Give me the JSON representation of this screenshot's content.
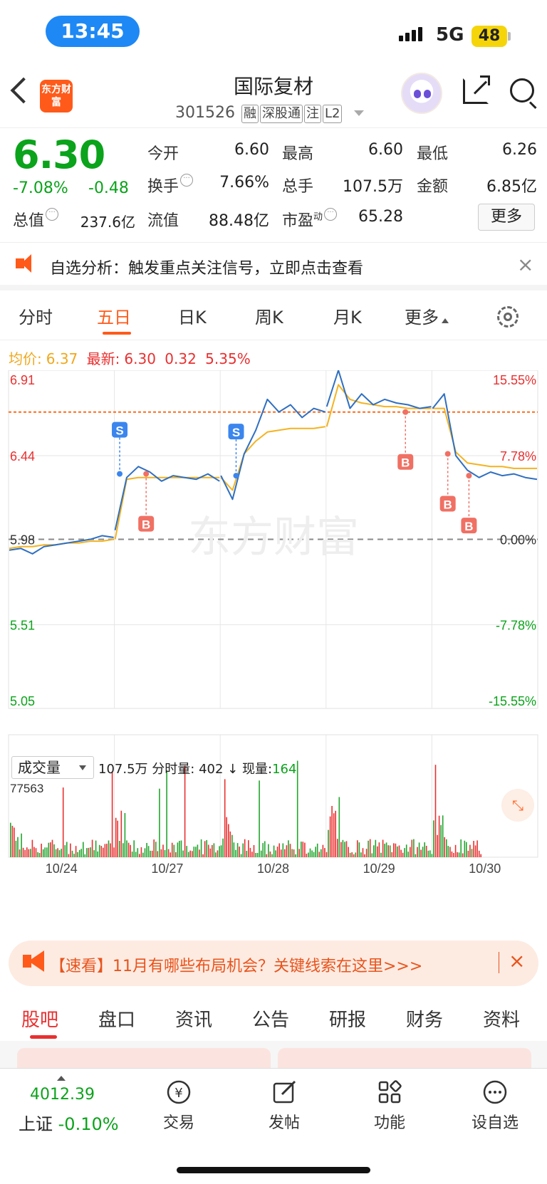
{
  "status_bar": {
    "time": "13:45",
    "network": "5G",
    "battery": "48"
  },
  "header": {
    "logo_text": "东方财富",
    "title": "国际复材",
    "code": "301526",
    "tags": [
      "融",
      "深股通",
      "注",
      "L2"
    ]
  },
  "quote": {
    "price": "6.30",
    "change_pct": "-7.08%",
    "change_amt": "-0.48",
    "open_label": "今开",
    "open": "6.60",
    "high_label": "最高",
    "high": "6.60",
    "low_label": "最低",
    "low": "6.26",
    "turnover_label": "换手",
    "turnover": "7.66%",
    "volume_label": "总手",
    "volume": "107.5万",
    "amount_label": "金额",
    "amount": "6.85亿",
    "mktcap_label": "总值",
    "mktcap": "237.6亿",
    "float_label": "流值",
    "float": "88.48亿",
    "pe_label": "市盈",
    "pe_sup": "动",
    "pe": "65.28",
    "more_label": "更多"
  },
  "notice": {
    "text": "自选分析：触发重点关注信号，立即点击查看",
    "close": "×"
  },
  "tabs": [
    "分时",
    "五日",
    "日K",
    "周K",
    "月K",
    "更多"
  ],
  "legend": {
    "avg_label": "均价:",
    "avg": "6.37",
    "latest_label": "最新:",
    "latest": "6.30",
    "change": "0.32",
    "change_pct": "5.35%"
  },
  "chart_data": {
    "type": "line",
    "title": "",
    "y_labels_left": [
      "6.91",
      "6.44",
      "5.98",
      "5.51",
      "5.05"
    ],
    "y_labels_right": [
      "15.55%",
      "7.78%",
      "0.00%",
      "-7.78%",
      "-15.55%"
    ],
    "ylim": [
      5.05,
      6.91
    ],
    "prev_close": 5.98,
    "latest": 6.3,
    "x_labels": [
      "10/24",
      "10/27",
      "10/28",
      "10/29",
      "10/30"
    ],
    "series": [
      {
        "name": "",
        "values": [
          5.92,
          5.93,
          5.9,
          5.94,
          5.95,
          5.96,
          5.97,
          5.98,
          6.0,
          5.99,
          6.03,
          6.32,
          6.38,
          6.35,
          6.3,
          6.33,
          6.32,
          6.31,
          6.34,
          6.3,
          6.33,
          6.2,
          6.45,
          6.58,
          6.75,
          6.68,
          6.72,
          6.65,
          6.7,
          6.68,
          6.71,
          6.91,
          6.7,
          6.78,
          6.72,
          6.75,
          6.73,
          6.72,
          6.7,
          6.71,
          6.7,
          6.78,
          6.44,
          6.36,
          6.32,
          6.35,
          6.33,
          6.34,
          6.32,
          6.31,
          6.3
        ]
      },
      {
        "name": "",
        "values": [
          5.93,
          5.94,
          5.94,
          5.95,
          5.95,
          5.96,
          5.96,
          5.97,
          5.97,
          5.98,
          5.98,
          6.31,
          6.32,
          6.32,
          6.32,
          6.32,
          6.32,
          6.32,
          6.32,
          6.32,
          6.32,
          6.25,
          6.45,
          6.52,
          6.57,
          6.58,
          6.59,
          6.59,
          6.59,
          6.6,
          6.6,
          6.83,
          6.75,
          6.73,
          6.72,
          6.71,
          6.71,
          6.7,
          6.7,
          6.7,
          6.7,
          6.7,
          6.46,
          6.4,
          6.39,
          6.38,
          6.38,
          6.37,
          6.37,
          6.37,
          6.37
        ]
      }
    ],
    "markers": [
      {
        "label": "S",
        "x": 0.21,
        "y": 6.34,
        "dir": "up"
      },
      {
        "label": "B",
        "x": 0.26,
        "y": 6.34,
        "dir": "down"
      },
      {
        "label": "S",
        "x": 0.43,
        "y": 6.33,
        "dir": "up"
      },
      {
        "label": "B",
        "x": 0.75,
        "y": 6.68,
        "dir": "down"
      },
      {
        "label": "B",
        "x": 0.83,
        "y": 6.45,
        "dir": "down"
      },
      {
        "label": "B",
        "x": 0.87,
        "y": 6.33,
        "dir": "down"
      }
    ],
    "volume_max_label": "77563",
    "watermark": "东方财富"
  },
  "volume_panel": {
    "select_label": "成交量",
    "total": "107.5万",
    "tick_label": "分时量:",
    "tick": "402",
    "arrow": "↓",
    "current_label": "现量:",
    "current": "164"
  },
  "banner": {
    "text": "【速看】11月有哪些布局机会？关键线索在这里>>>",
    "close": "×"
  },
  "bottom_tabs": [
    "股吧",
    "盘口",
    "资讯",
    "公告",
    "研报",
    "财务",
    "资料"
  ],
  "bottom_bar": {
    "index_value": "4012.39",
    "index_name": "上证",
    "index_change": "-0.10%",
    "items": [
      "交易",
      "发帖",
      "功能",
      "设自选"
    ]
  },
  "colors": {
    "up": "#e93030",
    "down": "#0ba31b",
    "line": "#2f6fc0",
    "avg": "#f4b321",
    "accent": "#ff5a1a"
  }
}
